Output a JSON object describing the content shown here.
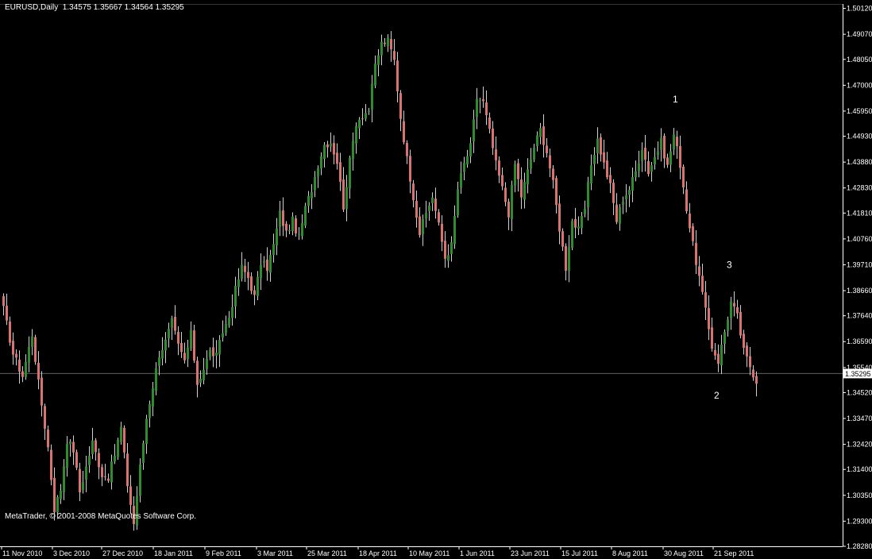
{
  "header": {
    "symbol": "EURUSD,Daily",
    "ohlc": "1.34575 1.35667 1.34564 1.35295"
  },
  "footer": {
    "copyright": "MetaTrader, © 2001-2008 MetaQuotes Software Corp."
  },
  "colors": {
    "background": "#000000",
    "bull": "#2e8b2e",
    "bear": "#d9736f",
    "wick": "#d0d0d0",
    "axis": "#ffffff",
    "bid_line": "#5f5f5f"
  },
  "chart_data": {
    "type": "candlestick",
    "ylim": [
      1.2828,
      1.503
    ],
    "y_ticks": [
      "1.50120",
      "1.49070",
      "1.48050",
      "1.47000",
      "1.45950",
      "1.44930",
      "1.43880",
      "1.42830",
      "1.41810",
      "1.40760",
      "1.39710",
      "1.38660",
      "1.37640",
      "1.36590",
      "1.35540",
      "1.34520",
      "1.33470",
      "1.32420",
      "1.31400",
      "1.30350",
      "1.29300",
      "1.28280"
    ],
    "x_labels": [
      "11 Nov 2010",
      "3 Dec 2010",
      "27 Dec 2010",
      "18 Jan 2011",
      "9 Feb 2011",
      "3 Mar 2011",
      "25 Mar 2011",
      "18 Apr 2011",
      "10 May 2011",
      "1 Jun 2011",
      "23 Jun 2011",
      "15 Jul 2011",
      "8 Aug 2011",
      "30 Aug 2011",
      "21 Sep 2011"
    ],
    "current_price": "1.35295",
    "close_path": [
      [
        0,
        1.379
      ],
      [
        3,
        1.361
      ],
      [
        6,
        1.352
      ],
      [
        9,
        1.369
      ],
      [
        11,
        1.349
      ],
      [
        14,
        1.323
      ],
      [
        16,
        1.298
      ],
      [
        18,
        1.306
      ],
      [
        20,
        1.326
      ],
      [
        22,
        1.322
      ],
      [
        24,
        1.305
      ],
      [
        26,
        1.315
      ],
      [
        28,
        1.325
      ],
      [
        31,
        1.312
      ],
      [
        33,
        1.311
      ],
      [
        35,
        1.32
      ],
      [
        37,
        1.331
      ],
      [
        39,
        1.308
      ],
      [
        41,
        1.292
      ],
      [
        43,
        1.315
      ],
      [
        45,
        1.335
      ],
      [
        47,
        1.348
      ],
      [
        49,
        1.361
      ],
      [
        51,
        1.366
      ],
      [
        53,
        1.374
      ],
      [
        55,
        1.364
      ],
      [
        57,
        1.358
      ],
      [
        59,
        1.369
      ],
      [
        61,
        1.349
      ],
      [
        63,
        1.355
      ],
      [
        65,
        1.362
      ],
      [
        67,
        1.36
      ],
      [
        69,
        1.37
      ],
      [
        71,
        1.376
      ],
      [
        73,
        1.387
      ],
      [
        75,
        1.396
      ],
      [
        77,
        1.392
      ],
      [
        79,
        1.384
      ],
      [
        81,
        1.398
      ],
      [
        83,
        1.396
      ],
      [
        85,
        1.405
      ],
      [
        87,
        1.418
      ],
      [
        89,
        1.41
      ],
      [
        91,
        1.415
      ],
      [
        93,
        1.408
      ],
      [
        95,
        1.42
      ],
      [
        97,
        1.428
      ],
      [
        99,
        1.438
      ],
      [
        101,
        1.446
      ],
      [
        103,
        1.447
      ],
      [
        105,
        1.439
      ],
      [
        107,
        1.421
      ],
      [
        109,
        1.439
      ],
      [
        111,
        1.455
      ],
      [
        113,
        1.458
      ],
      [
        115,
        1.46
      ],
      [
        117,
        1.478
      ],
      [
        119,
        1.487
      ],
      [
        121,
        1.488
      ],
      [
        123,
        1.48
      ],
      [
        125,
        1.457
      ],
      [
        127,
        1.44
      ],
      [
        129,
        1.425
      ],
      [
        131,
        1.41
      ],
      [
        133,
        1.418
      ],
      [
        135,
        1.425
      ],
      [
        137,
        1.413
      ],
      [
        139,
        1.4
      ],
      [
        141,
        1.405
      ],
      [
        143,
        1.428
      ],
      [
        145,
        1.438
      ],
      [
        147,
        1.445
      ],
      [
        149,
        1.465
      ],
      [
        151,
        1.463
      ],
      [
        153,
        1.451
      ],
      [
        155,
        1.438
      ],
      [
        157,
        1.428
      ],
      [
        159,
        1.418
      ],
      [
        161,
        1.438
      ],
      [
        163,
        1.425
      ],
      [
        165,
        1.435
      ],
      [
        167,
        1.445
      ],
      [
        169,
        1.452
      ],
      [
        171,
        1.443
      ],
      [
        173,
        1.43
      ],
      [
        175,
        1.412
      ],
      [
        177,
        1.396
      ],
      [
        179,
        1.415
      ],
      [
        181,
        1.411
      ],
      [
        183,
        1.42
      ],
      [
        185,
        1.438
      ],
      [
        187,
        1.448
      ],
      [
        189,
        1.438
      ],
      [
        191,
        1.429
      ],
      [
        193,
        1.415
      ],
      [
        195,
        1.424
      ],
      [
        197,
        1.428
      ],
      [
        199,
        1.435
      ],
      [
        201,
        1.445
      ],
      [
        203,
        1.435
      ],
      [
        205,
        1.441
      ],
      [
        207,
        1.447
      ],
      [
        209,
        1.437
      ],
      [
        211,
        1.45
      ],
      [
        213,
        1.438
      ],
      [
        215,
        1.42
      ],
      [
        217,
        1.405
      ],
      [
        219,
        1.392
      ],
      [
        221,
        1.378
      ],
      [
        223,
        1.364
      ],
      [
        225,
        1.358
      ],
      [
        227,
        1.37
      ],
      [
        229,
        1.382
      ],
      [
        231,
        1.376
      ],
      [
        233,
        1.362
      ],
      [
        235,
        1.356
      ],
      [
        237,
        1.35
      ]
    ],
    "annotations": [
      {
        "text": "1",
        "bar": 211,
        "price": 1.463
      },
      {
        "text": "2",
        "bar": 224,
        "price": 1.3428
      },
      {
        "text": "3",
        "bar": 228,
        "price": 1.3958
      }
    ]
  }
}
